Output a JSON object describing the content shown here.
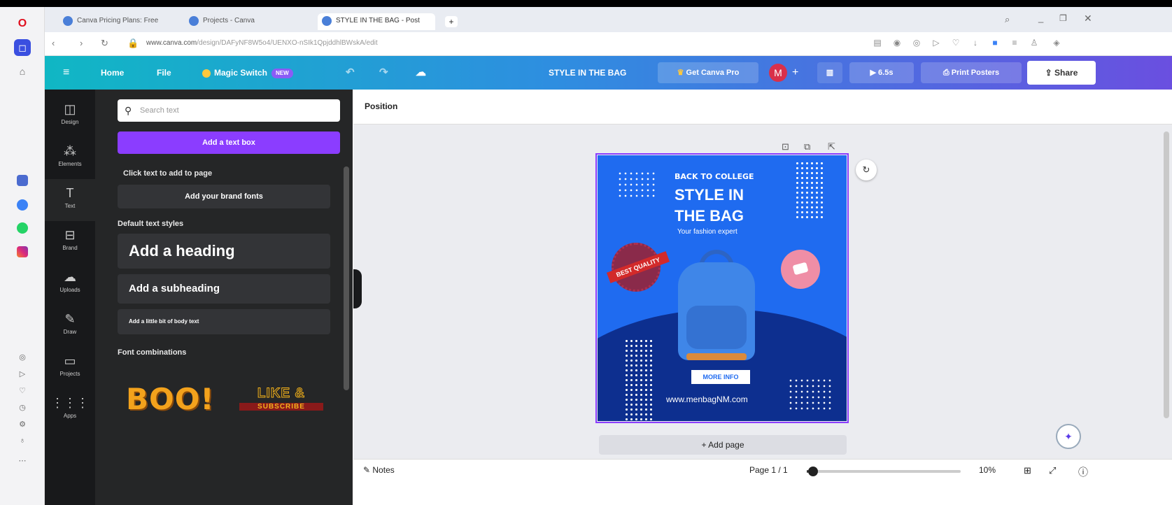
{
  "browser": {
    "tabs": [
      {
        "label": "Canva Pricing Plans: Free"
      },
      {
        "label": "Projects - Canva"
      },
      {
        "label": "STYLE IN THE BAG - Post"
      }
    ],
    "url_domain": "www.canva.com",
    "url_path": "/design/DAFyNF8W5o4/UENXO-nSIk1QpjddhlBWskA/edit"
  },
  "topbar": {
    "home_label": "Home",
    "file_label": "File",
    "magic_switch_label": "Magic Switch",
    "new_badge": "NEW",
    "design_title": "STYLE IN THE BAG",
    "get_pro_label": "Get Canva Pro",
    "avatar_initial": "M",
    "play_label": "6.5s",
    "print_label": "Print Posters",
    "share_label": "Share"
  },
  "rail": {
    "items": [
      {
        "label": "Design"
      },
      {
        "label": "Elements"
      },
      {
        "label": "Text"
      },
      {
        "label": "Brand"
      },
      {
        "label": "Uploads"
      },
      {
        "label": "Draw"
      },
      {
        "label": "Projects"
      },
      {
        "label": "Apps"
      }
    ]
  },
  "panel": {
    "search_placeholder": "Search text",
    "add_text_box": "Add a text box",
    "click_text_hint": "Click text to add to page",
    "brand_fonts": "Add your brand fonts",
    "default_styles_heading": "Default text styles",
    "heading_btn": "Add a heading",
    "subheading_btn": "Add a subheading",
    "body_btn": "Add a little bit of body text",
    "font_combos_heading": "Font combinations",
    "combo1": "BOO!",
    "combo2": "LIKE &",
    "combo2_sub": "SUBSCRIBE"
  },
  "canvas": {
    "position_label": "Position",
    "add_page": "+ Add page"
  },
  "poster": {
    "kicker": "BACK TO COLLEGE",
    "title_line1": "STYLE IN",
    "title_line2": "THE BAG",
    "tagline": "Your fashion expert",
    "badge_text": "BEST QUALITY",
    "cta": "MORE INFO",
    "website": "www.menbagNM.com",
    "bg_color": "#1f6bf0",
    "arc_color": "#0d2f8f"
  },
  "bottombar": {
    "notes_label": "Notes",
    "page_indicator": "Page 1 / 1",
    "zoom": "10%",
    "zoom_level": 0.1
  }
}
